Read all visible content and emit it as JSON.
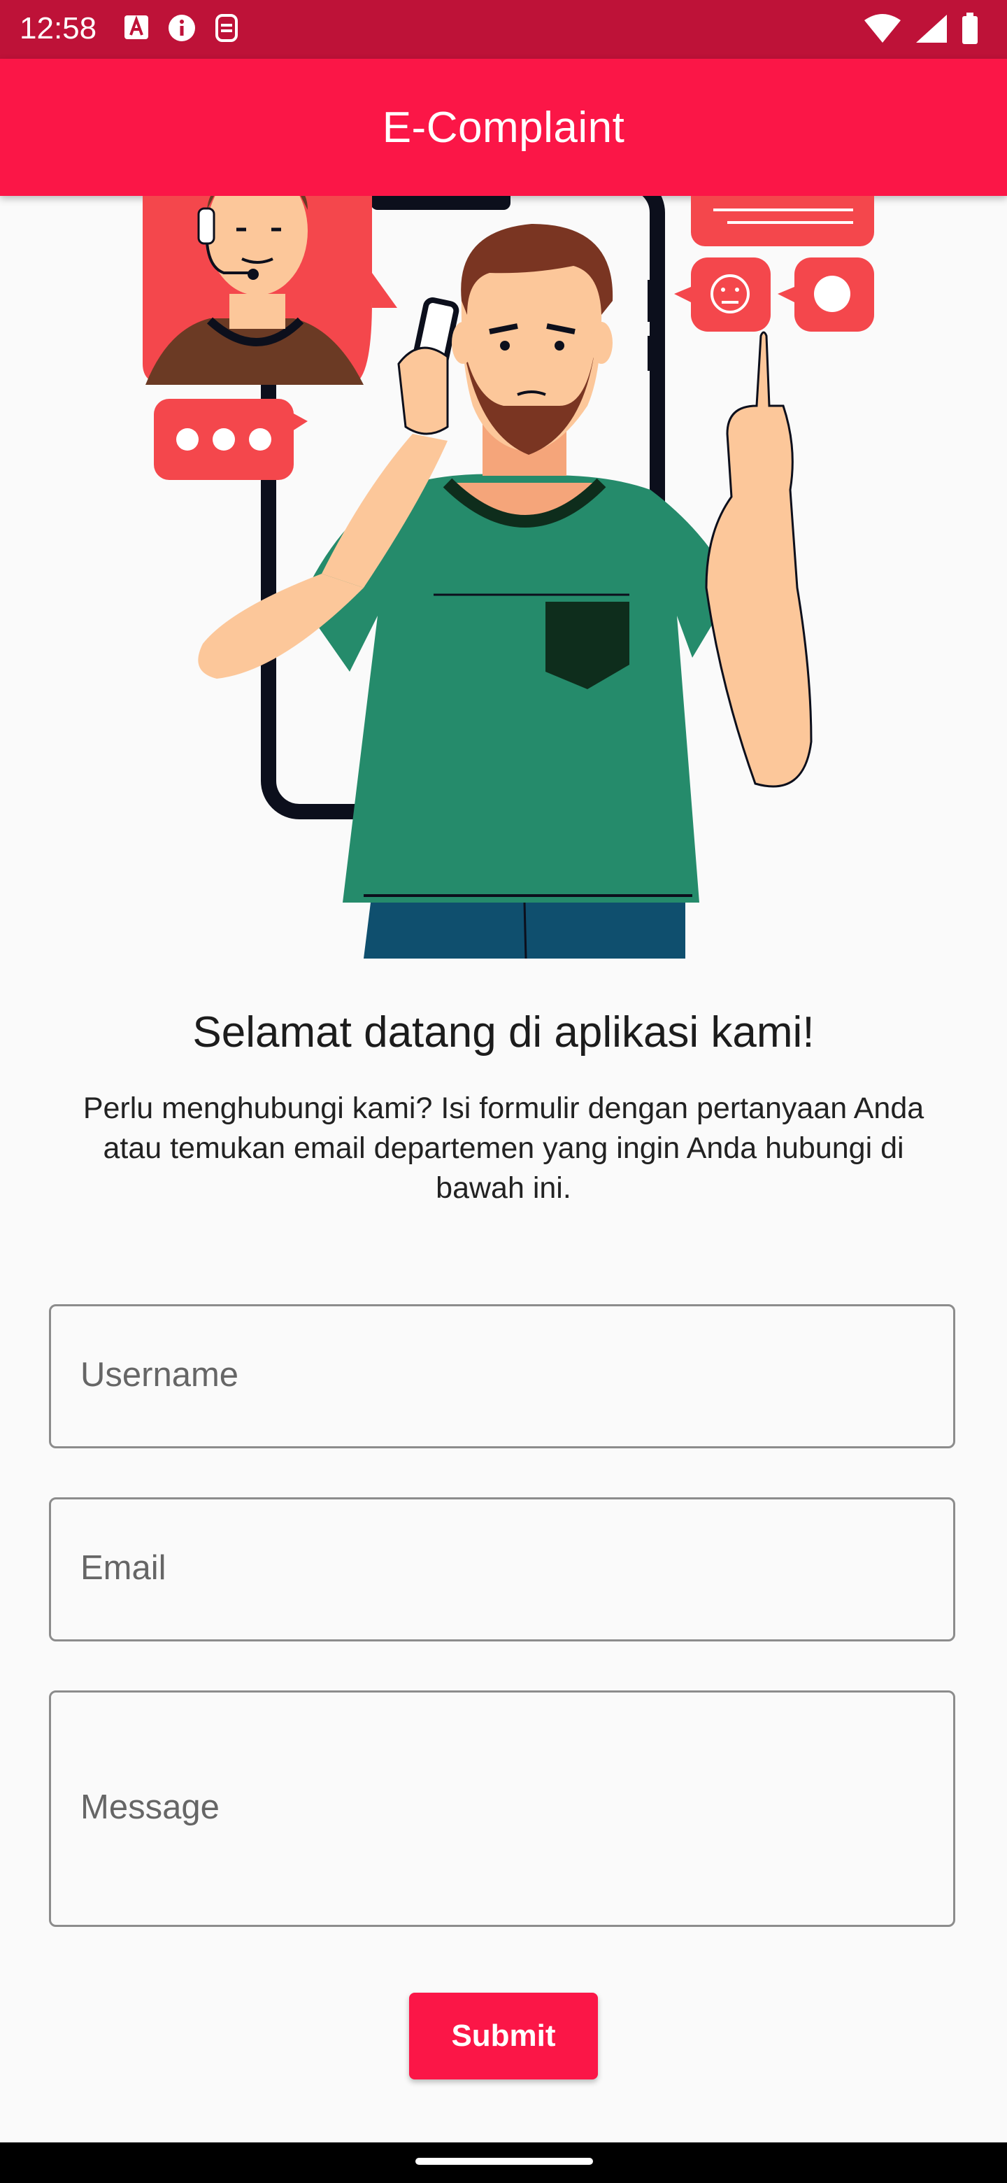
{
  "status_bar": {
    "time": "12:58",
    "left_icons": [
      "a-icon",
      "info-icon",
      "screen-record-icon"
    ],
    "right_icons": [
      "wifi-icon",
      "signal-icon",
      "battery-icon"
    ]
  },
  "app_bar": {
    "title": "E-Complaint"
  },
  "illustration": {
    "subject": "customer-support-call-icon"
  },
  "welcome": {
    "heading": "Selamat datang di aplikasi kami!",
    "description": "Perlu menghubungi kami? Isi formulir dengan pertanyaan Anda atau temukan email departemen yang ingin Anda hubungi di bawah ini."
  },
  "form": {
    "username_placeholder": "Username",
    "email_placeholder": "Email",
    "message_placeholder": "Message",
    "submit_label": "Submit"
  },
  "colors": {
    "status_bar": "#be1238",
    "app_bar": "#fb1647",
    "accent": "#fb1647",
    "background": "#fafafa"
  }
}
